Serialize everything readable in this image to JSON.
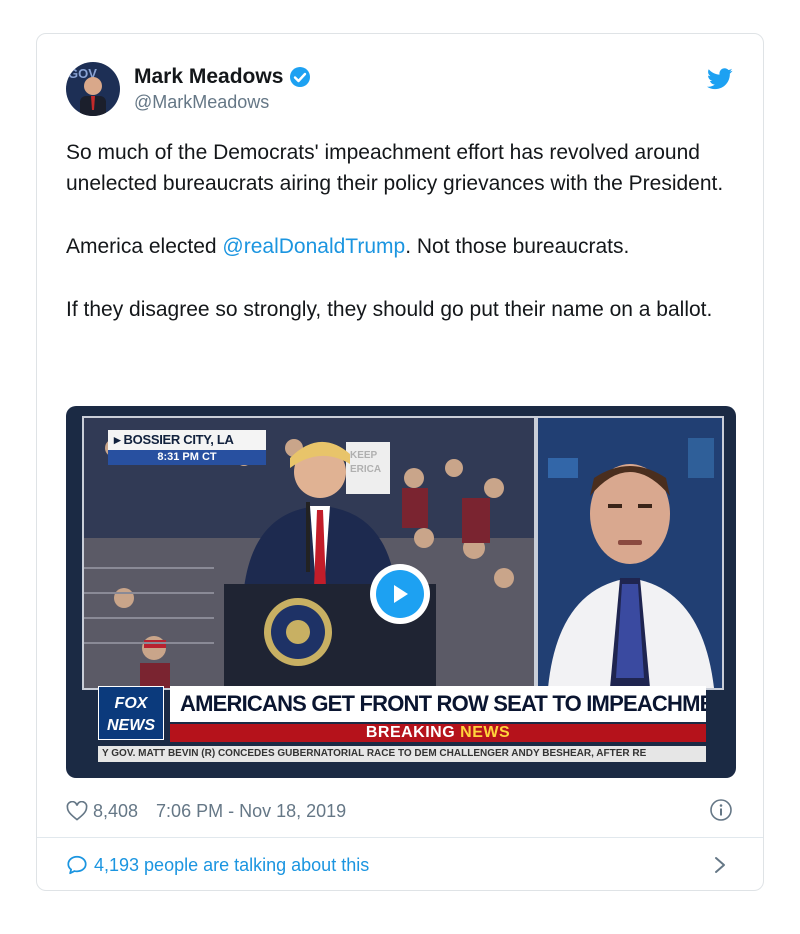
{
  "author": {
    "display_name": "Mark Meadows",
    "handle": "@MarkMeadows",
    "verified": true
  },
  "tweet": {
    "paragraph1": "So much of the Democrats' impeachment effort has revolved around unelected bureaucrats airing their policy grievances with the President.",
    "paragraph2_before": "America elected ",
    "paragraph2_mention": "@realDonaldTrump",
    "paragraph2_after": ". Not those bureaucrats.",
    "paragraph3": "If they disagree so strongly, they should go put their name on a ballot."
  },
  "media": {
    "location": "BOSSIER CITY, LA",
    "time": "8:31 PM CT",
    "network_logo_line1": "FOX",
    "network_logo_line2": "NEWS",
    "headline": "AMERICANS GET FRONT ROW SEAT TO IMPEACHMENT SHAM",
    "breaking_label": "BREAKING",
    "breaking_news": "NEWS",
    "ticker": "Y GOV. MATT BEVIN (R) CONCEDES GUBERNATORIAL RACE TO DEM CHALLENGER ANDY BESHEAR, AFTER RE",
    "sign_text": "KEEP AMERICA"
  },
  "meta": {
    "like_count": "8,408",
    "timestamp": "7:06 PM - Nov 18, 2019"
  },
  "footer": {
    "talking_text": "4,193 people are talking about this"
  },
  "colors": {
    "link": "#1b95e0",
    "twitter_blue": "#1da1f2",
    "secondary_text": "#657786",
    "fox_red": "#b5121b"
  }
}
